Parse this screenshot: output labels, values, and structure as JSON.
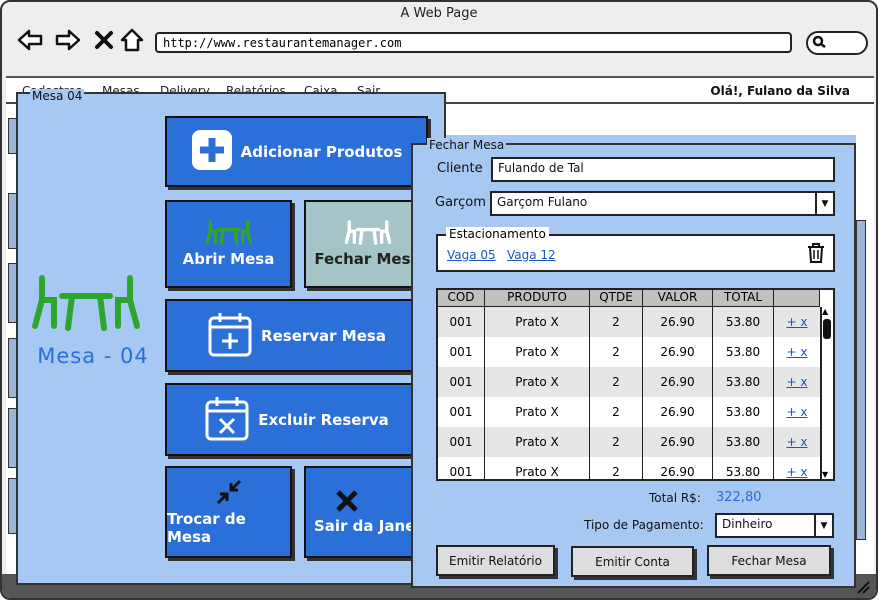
{
  "browser": {
    "title": "A Web Page",
    "url": "http://www.restaurantemanager.com"
  },
  "menubar": {
    "items": [
      "Cadastros",
      "Mesas",
      "Delivery",
      "Relatórios",
      "Caixa",
      "Sair"
    ],
    "greeting": "Olá!, Fulano da Silva"
  },
  "mesa_window": {
    "title": "Mesa 04",
    "table_label": "Mesa - 04",
    "buttons": {
      "adicionar": "Adicionar Produtos",
      "abrir": "Abrir Mesa",
      "fechar": "Fechar Mesa",
      "reservar": "Reservar Mesa",
      "excluir": "Excluir Reserva",
      "trocar": "Trocar de Mesa",
      "sair": "Sair da Janela"
    }
  },
  "fechar_window": {
    "title": "Fechar Mesa",
    "cliente_label": "Cliente",
    "cliente_value": "Fulando de Tal",
    "garcom_label": "Garçom",
    "garcom_value": "Garçom Fulano",
    "estacionamento_label": "Estacionamento",
    "vagas": [
      "Vaga 05",
      "Vaga 12"
    ],
    "table": {
      "headers": [
        "COD",
        "PRODUTO",
        "QTDE",
        "VALOR",
        "TOTAL"
      ],
      "rows": [
        [
          "001",
          "Prato X",
          "2",
          "26.90",
          "53.80"
        ],
        [
          "001",
          "Prato X",
          "2",
          "26.90",
          "53.80"
        ],
        [
          "001",
          "Prato X",
          "2",
          "26.90",
          "53.80"
        ],
        [
          "001",
          "Prato X",
          "2",
          "26.90",
          "53.80"
        ],
        [
          "001",
          "Prato X",
          "2",
          "26.90",
          "53.80"
        ],
        [
          "001",
          "Prato X",
          "2",
          "26.90",
          "53.80"
        ]
      ],
      "action_label": "+ x"
    },
    "total_label": "Total R$:",
    "total_value": "322,80",
    "pagamento_label": "Tipo de Pagamento:",
    "pagamento_value": "Dinheiro",
    "buttons": {
      "relatorio": "Emitir Relatório",
      "conta": "Emitir Conta",
      "fechar": "Fechar Mesa"
    }
  },
  "colors": {
    "accent": "#2b6fd9",
    "panel": "#a7c8f2",
    "table_icon": "#2ea52e"
  }
}
